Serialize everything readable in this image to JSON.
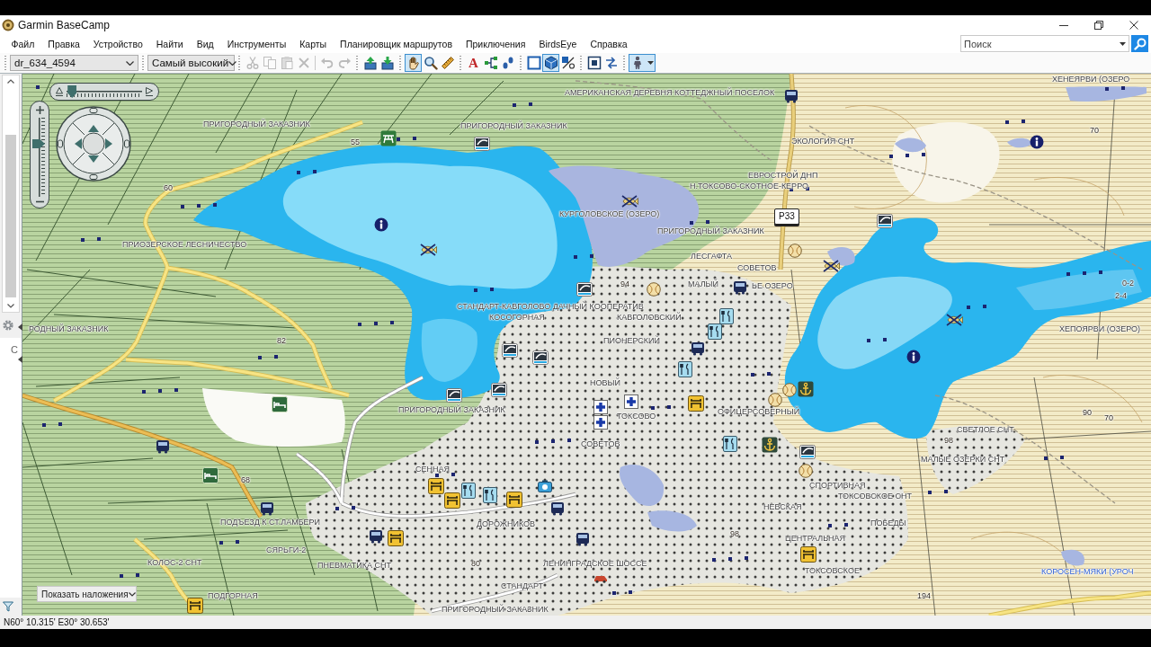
{
  "window": {
    "title": "Garmin BaseCamp"
  },
  "menu": [
    "Файл",
    "Правка",
    "Устройство",
    "Найти",
    "Вид",
    "Инструменты",
    "Карты",
    "Планировщик маршрутов",
    "Приключения",
    "BirdsEye",
    "Справка"
  ],
  "search": {
    "placeholder": "Поиск"
  },
  "toolbar": {
    "library": {
      "value": "dr_634_4594"
    },
    "detail": {
      "value": "Самый высокий"
    },
    "buttons": [
      {
        "kind": "icon",
        "disabled": true,
        "selected": false
      },
      {
        "kind": "icon",
        "disabled": true,
        "selected": false
      },
      {
        "kind": "icon",
        "disabled": true,
        "selected": false
      },
      {
        "kind": "icon",
        "disabled": true,
        "selected": false
      },
      {
        "kind": "icon",
        "disabled": true,
        "selected": false
      },
      {
        "kind": "icon",
        "disabled": true,
        "selected": false
      },
      {
        "kind": "icon",
        "disabled": false,
        "selected": false
      },
      {
        "kind": "icon",
        "disabled": false,
        "selected": false
      },
      {
        "kind": "icon",
        "disabled": false,
        "selected": true
      },
      {
        "kind": "icon",
        "disabled": false,
        "selected": false
      },
      {
        "kind": "icon",
        "disabled": false,
        "selected": false
      },
      {
        "kind": "letter",
        "glyph": "A",
        "disabled": false,
        "selected": false
      },
      {
        "kind": "icon",
        "disabled": false,
        "selected": false
      },
      {
        "kind": "icon",
        "disabled": false,
        "selected": false
      },
      {
        "kind": "icon",
        "disabled": false,
        "selected": false
      },
      {
        "kind": "icon",
        "disabled": false,
        "selected": true
      },
      {
        "kind": "icon",
        "disabled": false,
        "selected": false
      },
      {
        "kind": "icon",
        "disabled": false,
        "selected": false
      },
      {
        "kind": "icon",
        "disabled": false,
        "selected": false
      },
      {
        "kind": "icon",
        "disabled": false,
        "selected": true
      }
    ]
  },
  "side_panel": {
    "label": "C"
  },
  "map": {
    "tilt_slider": {
      "level": 0.05
    },
    "zoom_slider": {
      "level": 0.67
    },
    "labels": [
      {
        "text": "ХЕНЕЯРВИ (ОЗЕРО",
        "kind": "place"
      },
      {
        "text": "АМЕРИКАНСКАЯ ДЕРЕВНЯ КОТТЕДЖНЫЙ ПОСЕЛОК",
        "kind": "place"
      },
      {
        "text": "ПРИГОРОДНЫЙ ЗАКАЗНИК",
        "kind": "place"
      },
      {
        "text": "ПРИГОРОДНЫЙ ЗАКАЗНИК",
        "kind": "place"
      },
      {
        "text": "70",
        "kind": "height"
      },
      {
        "text": "55",
        "kind": "height"
      },
      {
        "text": "ЭКОЛОГИЯ СНТ",
        "kind": "place"
      },
      {
        "text": "ЕВРОСТРОЙ ДНП",
        "kind": "place"
      },
      {
        "text": "60",
        "kind": "height"
      },
      {
        "text": "Н.ТОКСОВО-СКОТНОЕ-КЕРРО",
        "kind": "place"
      },
      {
        "text": "КУРГОЛОВСКОЕ (ОЗЕРО)",
        "kind": "place"
      },
      {
        "text": "P33",
        "kind": "shield"
      },
      {
        "text": "ПРИГОРОДНЫЙ ЗАКАЗНИК",
        "kind": "place"
      },
      {
        "text": "ПРИОЗЕРСКОЕ ЛЕСНИЧЕСТВО",
        "kind": "place"
      },
      {
        "text": "ЛЕСГАФТА",
        "kind": "place"
      },
      {
        "text": "СОВЕТОВ",
        "kind": "place"
      },
      {
        "text": "94",
        "kind": "height"
      },
      {
        "text": "МАЛЫЙ",
        "kind": "place"
      },
      {
        "text": "ЬЕ ОЗЕРО",
        "kind": "place"
      },
      {
        "text": "0-2",
        "kind": "depth"
      },
      {
        "text": "2-4",
        "kind": "depth"
      },
      {
        "text": "СТАНДАРТ-КАВГОЛОВО ДАЧНЫЙ КООПЕРАТИВ",
        "kind": "place"
      },
      {
        "text": "КОСОГОРНАЯ",
        "kind": "place"
      },
      {
        "text": "КАВГОЛОВСКИЙ",
        "kind": "place"
      },
      {
        "text": "РОДНЫЙ ЗАКАЗНИК",
        "kind": "place"
      },
      {
        "text": "ХЕПОЯРВИ (ОЗЕРО)",
        "kind": "place"
      },
      {
        "text": "82",
        "kind": "height"
      },
      {
        "text": "ПИОНЕРСКИЙ",
        "kind": "place"
      },
      {
        "text": "НОВЫЙ",
        "kind": "place"
      },
      {
        "text": "ПРИГОРОДНЫЙ ЗАКАЗНИК",
        "kind": "place"
      },
      {
        "text": "ТОКСОВО",
        "kind": "place"
      },
      {
        "text": "ОФИЦЕРСОВЕРНЫЙ",
        "kind": "place"
      },
      {
        "text": "90",
        "kind": "height"
      },
      {
        "text": "70",
        "kind": "height"
      },
      {
        "text": "СВЕТЛОЕ СНТ",
        "kind": "place"
      },
      {
        "text": "СОВЕТОВ",
        "kind": "place"
      },
      {
        "text": "98",
        "kind": "height"
      },
      {
        "text": "МАЛЫЕ ОЗЕРКИ СНТ",
        "kind": "place"
      },
      {
        "text": "СЕННАЯ",
        "kind": "place"
      },
      {
        "text": "68",
        "kind": "height"
      },
      {
        "text": "СПОРТИВНАЯ",
        "kind": "place"
      },
      {
        "text": "ТОКСОВСКОЕ СНТ",
        "kind": "place"
      },
      {
        "text": "НЕВСКАЯ",
        "kind": "place"
      },
      {
        "text": "ПОДЪЕЗД К СТ.ЛАМБЕРИ",
        "kind": "place"
      },
      {
        "text": "ДОРОЖНИКОВ",
        "kind": "place"
      },
      {
        "text": "ПОБЕДЫ",
        "kind": "place"
      },
      {
        "text": "98",
        "kind": "height"
      },
      {
        "text": "ЦЕНТРАЛЬНАЯ",
        "kind": "place"
      },
      {
        "text": "СЯРЬГИ-2",
        "kind": "place"
      },
      {
        "text": "КОЛОС-2 СНТ",
        "kind": "place"
      },
      {
        "text": "ПНЕВМАТИКА СНТ",
        "kind": "place"
      },
      {
        "text": "80",
        "kind": "height"
      },
      {
        "text": "ЛЕНИНГРАДСКОЕ ШОССЕ",
        "kind": "place"
      },
      {
        "text": "ТОКСОВСКОЕ",
        "kind": "place"
      },
      {
        "text": "КОРОСЕН-МЯКИ (УРОЧ",
        "kind": "tract"
      },
      {
        "text": "СТАНДАРТ",
        "kind": "place"
      },
      {
        "text": "ПОДГОРНАЯ",
        "kind": "place"
      },
      {
        "text": "194",
        "kind": "height"
      },
      {
        "text": "ПРИГОРОДНЫЙ ЗАКАЗНИК",
        "kind": "place"
      }
    ],
    "overlay_menu": {
      "value": "Показать наложения"
    }
  },
  "status_bar": {
    "coordinates": "N60° 10.315' E30° 30.653'"
  }
}
